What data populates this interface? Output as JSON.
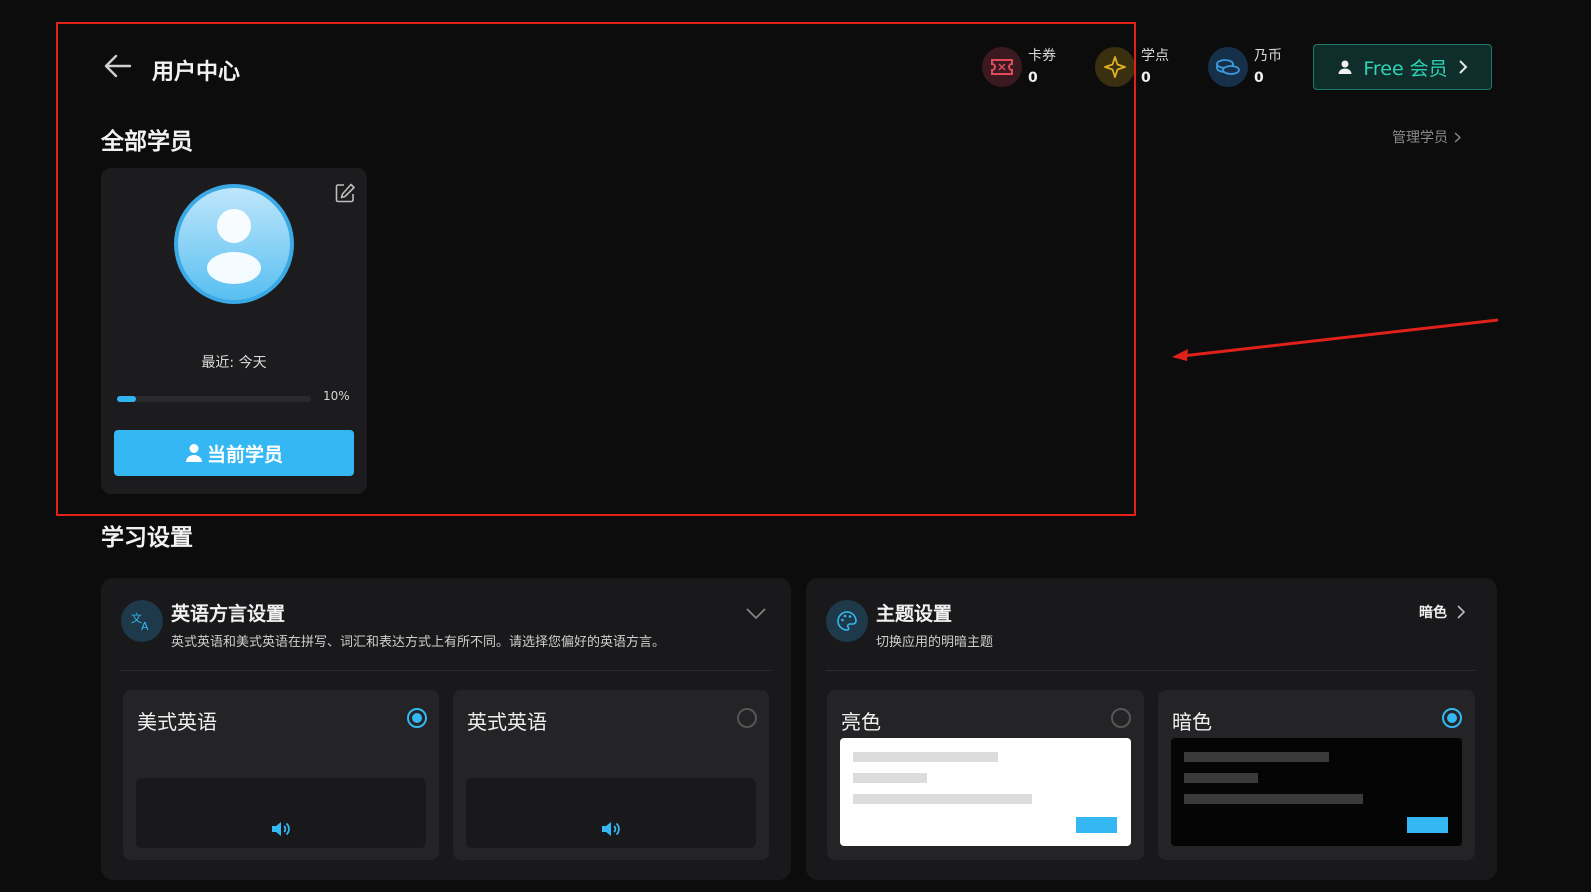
{
  "header": {
    "title": "用户中心",
    "stats": [
      {
        "label": "卡券",
        "value": "0",
        "icon": "ticket-icon",
        "color": "#e04a5a",
        "bg": "#3a1a20"
      },
      {
        "label": "学点",
        "value": "0",
        "icon": "star-icon",
        "color": "#e0b020",
        "bg": "#3a3010"
      },
      {
        "label": "乃币",
        "value": "0",
        "icon": "coins-icon",
        "color": "#3a9be0",
        "bg": "#16304a"
      }
    ],
    "member_button": "Free 会员"
  },
  "students": {
    "title": "全部学员",
    "manage_link": "管理学员",
    "card": {
      "recent": "最近: 今天",
      "progress": 0.1,
      "progress_text": "10%",
      "current_button": "当前学员"
    }
  },
  "settings": {
    "title": "学习设置",
    "dialect": {
      "title": "英语方言设置",
      "desc": "英式英语和美式英语在拼写、词汇和表达方式上有所不同。请选择您偏好的英语方言。",
      "options": [
        {
          "label": "美式英语",
          "selected": true
        },
        {
          "label": "英式英语",
          "selected": false
        }
      ]
    },
    "theme": {
      "title": "主题设置",
      "desc": "切换应用的明暗主题",
      "current": "暗色",
      "options": [
        {
          "label": "亮色",
          "selected": false
        },
        {
          "label": "暗色",
          "selected": true
        }
      ]
    }
  },
  "colors": {
    "accent": "#34b7f2",
    "member": "#2ed3b5",
    "annotation": "#e0211a"
  }
}
